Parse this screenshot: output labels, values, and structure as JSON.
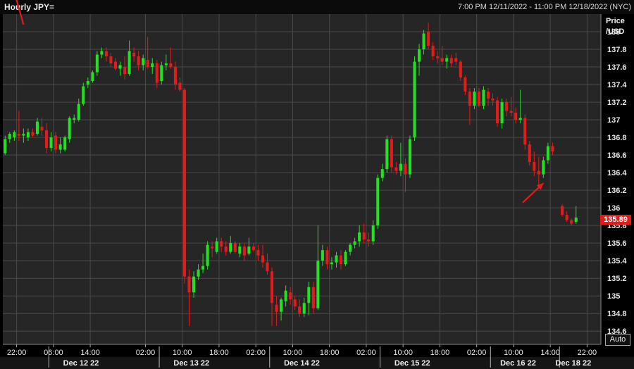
{
  "header": {
    "title": "Hourly JPY=",
    "range": "7:00 PM 12/11/2022 - 11:00 PM 12/18/2022 (NYC)"
  },
  "axis": {
    "ylabel_line1": "Price",
    "ylabel_line2": "/USD",
    "auto_label": "Auto"
  },
  "last_price": "135.89",
  "colors": {
    "up": "#22e022",
    "down": "#e41b1b",
    "background": "#262626"
  },
  "chart_data": {
    "type": "candlestick",
    "ylim": [
      134.45,
      138.2
    ],
    "yticks": [
      {
        "value": 138,
        "label": "138"
      },
      {
        "value": 137.8,
        "label": "137.8"
      },
      {
        "value": 137.6,
        "label": "137.6"
      },
      {
        "value": 137.4,
        "label": "137.4"
      },
      {
        "value": 137.2,
        "label": "137.2"
      },
      {
        "value": 137,
        "label": "137"
      },
      {
        "value": 136.8,
        "label": "136.8"
      },
      {
        "value": 136.6,
        "label": "136.6"
      },
      {
        "value": 136.4,
        "label": "136.4"
      },
      {
        "value": 136.2,
        "label": "136.2"
      },
      {
        "value": 136,
        "label": "136"
      },
      {
        "value": 135.8,
        "label": "135.8"
      },
      {
        "value": 135.6,
        "label": "135.6"
      },
      {
        "value": 135.4,
        "label": "135.4"
      },
      {
        "value": 135.2,
        "label": "135.2"
      },
      {
        "value": 135,
        "label": "135"
      },
      {
        "value": 134.8,
        "label": "134.8"
      },
      {
        "value": 134.6,
        "label": "134.6"
      }
    ],
    "time_ticks": [
      {
        "t": 0,
        "label": "22:00"
      },
      {
        "t": 8,
        "label": "06:00"
      },
      {
        "t": 16,
        "label": "14:00"
      },
      {
        "t": 28,
        "label": "02:00"
      },
      {
        "t": 36,
        "label": "10:00"
      },
      {
        "t": 44,
        "label": "18:00"
      },
      {
        "t": 52,
        "label": "02:00"
      },
      {
        "t": 60,
        "label": "10:00"
      },
      {
        "t": 68,
        "label": "18:00"
      },
      {
        "t": 76,
        "label": "02:00"
      },
      {
        "t": 84,
        "label": "10:00"
      },
      {
        "t": 92,
        "label": "18:00"
      },
      {
        "t": 100,
        "label": "02:00"
      },
      {
        "t": 108,
        "label": "10:00"
      },
      {
        "t": 116,
        "label": "14:00"
      },
      {
        "t": 124,
        "label": "22:00"
      }
    ],
    "date_labels": [
      {
        "t": 14,
        "label": "Dec 12 22"
      },
      {
        "t": 38,
        "label": "Dec 13 22"
      },
      {
        "t": 62,
        "label": "Dec 14 22"
      },
      {
        "t": 86,
        "label": "Dec 15 22"
      },
      {
        "t": 109,
        "label": "Dec 16 22"
      },
      {
        "t": 121,
        "label": "Dec 18 22"
      }
    ],
    "date_separators": [
      7,
      31,
      55,
      79,
      103,
      118
    ],
    "x_domain": [
      -3,
      127
    ],
    "candles": [
      {
        "t": -2.5,
        "o": 136.62,
        "h": 136.82,
        "l": 136.6,
        "c": 136.78
      },
      {
        "t": -1.5,
        "o": 136.78,
        "h": 136.86,
        "l": 136.74,
        "c": 136.84
      },
      {
        "t": -0.5,
        "o": 136.8,
        "h": 136.88,
        "l": 136.76,
        "c": 136.86
      },
      {
        "t": 0.5,
        "o": 136.84,
        "h": 137.1,
        "l": 136.76,
        "c": 136.82
      },
      {
        "t": 1.5,
        "o": 136.82,
        "h": 136.9,
        "l": 136.74,
        "c": 136.84
      },
      {
        "t": 2.5,
        "o": 136.8,
        "h": 136.9,
        "l": 136.76,
        "c": 136.86
      },
      {
        "t": 3.5,
        "o": 136.86,
        "h": 136.9,
        "l": 136.8,
        "c": 136.82
      },
      {
        "t": 4.5,
        "o": 136.84,
        "h": 137.02,
        "l": 136.82,
        "c": 136.98
      },
      {
        "t": 5.5,
        "o": 136.92,
        "h": 137.02,
        "l": 136.82,
        "c": 136.88
      },
      {
        "t": 6.5,
        "o": 136.88,
        "h": 136.96,
        "l": 136.62,
        "c": 136.68
      },
      {
        "t": 7.5,
        "o": 136.68,
        "h": 136.86,
        "l": 136.64,
        "c": 136.8
      },
      {
        "t": 8.5,
        "o": 136.82,
        "h": 136.86,
        "l": 136.62,
        "c": 136.66
      },
      {
        "t": 9.5,
        "o": 136.66,
        "h": 136.8,
        "l": 136.62,
        "c": 136.72
      },
      {
        "t": 10.5,
        "o": 136.66,
        "h": 136.82,
        "l": 136.64,
        "c": 136.8
      },
      {
        "t": 11.5,
        "o": 136.78,
        "h": 137.04,
        "l": 136.74,
        "c": 137.02
      },
      {
        "t": 12.5,
        "o": 137.0,
        "h": 137.06,
        "l": 136.96,
        "c": 137.02
      },
      {
        "t": 13.5,
        "o": 137.0,
        "h": 137.24,
        "l": 136.98,
        "c": 137.18
      },
      {
        "t": 14.5,
        "o": 137.18,
        "h": 137.42,
        "l": 137.16,
        "c": 137.38
      },
      {
        "t": 15.5,
        "o": 137.4,
        "h": 137.48,
        "l": 137.36,
        "c": 137.44
      },
      {
        "t": 16.5,
        "o": 137.44,
        "h": 137.56,
        "l": 137.42,
        "c": 137.54
      },
      {
        "t": 17.5,
        "o": 137.54,
        "h": 137.78,
        "l": 137.5,
        "c": 137.74
      },
      {
        "t": 18.5,
        "o": 137.74,
        "h": 137.82,
        "l": 137.7,
        "c": 137.78
      },
      {
        "t": 19.5,
        "o": 137.78,
        "h": 137.82,
        "l": 137.66,
        "c": 137.72
      },
      {
        "t": 20.5,
        "o": 137.72,
        "h": 137.76,
        "l": 137.6,
        "c": 137.64
      },
      {
        "t": 21.5,
        "o": 137.66,
        "h": 137.7,
        "l": 137.56,
        "c": 137.58
      },
      {
        "t": 22.5,
        "o": 137.58,
        "h": 137.66,
        "l": 137.5,
        "c": 137.62
      },
      {
        "t": 23.5,
        "o": 137.6,
        "h": 137.72,
        "l": 137.46,
        "c": 137.52
      },
      {
        "t": 24.5,
        "o": 137.52,
        "h": 137.9,
        "l": 137.5,
        "c": 137.78
      },
      {
        "t": 25.5,
        "o": 137.76,
        "h": 137.82,
        "l": 137.66,
        "c": 137.72
      },
      {
        "t": 26.5,
        "o": 137.72,
        "h": 137.78,
        "l": 137.56,
        "c": 137.62
      },
      {
        "t": 27.5,
        "o": 137.62,
        "h": 137.74,
        "l": 137.56,
        "c": 137.7
      },
      {
        "t": 28.5,
        "o": 137.68,
        "h": 137.94,
        "l": 137.58,
        "c": 137.6
      },
      {
        "t": 29.5,
        "o": 137.6,
        "h": 137.7,
        "l": 137.52,
        "c": 137.64
      },
      {
        "t": 30.5,
        "o": 137.64,
        "h": 137.68,
        "l": 137.36,
        "c": 137.42
      },
      {
        "t": 31.5,
        "o": 137.44,
        "h": 137.66,
        "l": 137.4,
        "c": 137.62
      },
      {
        "t": 32.5,
        "o": 137.62,
        "h": 137.74,
        "l": 137.56,
        "c": 137.64
      },
      {
        "t": 33.5,
        "o": 137.64,
        "h": 137.82,
        "l": 137.58,
        "c": 137.6
      },
      {
        "t": 34.5,
        "o": 137.6,
        "h": 137.66,
        "l": 137.34,
        "c": 137.4
      },
      {
        "t": 35.5,
        "o": 137.42,
        "h": 137.48,
        "l": 137.32,
        "c": 137.34
      },
      {
        "t": 36.5,
        "o": 137.34,
        "h": 137.36,
        "l": 135.14,
        "c": 135.22
      },
      {
        "t": 37.5,
        "o": 135.22,
        "h": 135.3,
        "l": 134.66,
        "c": 135.04
      },
      {
        "t": 38.5,
        "o": 135.04,
        "h": 135.28,
        "l": 134.98,
        "c": 135.22
      },
      {
        "t": 39.5,
        "o": 135.22,
        "h": 135.36,
        "l": 135.18,
        "c": 135.3
      },
      {
        "t": 40.5,
        "o": 135.3,
        "h": 135.48,
        "l": 135.26,
        "c": 135.34
      },
      {
        "t": 41.5,
        "o": 135.34,
        "h": 135.62,
        "l": 135.3,
        "c": 135.58
      },
      {
        "t": 42.5,
        "o": 135.56,
        "h": 135.62,
        "l": 135.44,
        "c": 135.54
      },
      {
        "t": 43.5,
        "o": 135.5,
        "h": 135.66,
        "l": 135.48,
        "c": 135.62
      },
      {
        "t": 44.5,
        "o": 135.62,
        "h": 135.66,
        "l": 135.5,
        "c": 135.56
      },
      {
        "t": 45.5,
        "o": 135.56,
        "h": 135.62,
        "l": 135.46,
        "c": 135.5
      },
      {
        "t": 46.5,
        "o": 135.5,
        "h": 135.68,
        "l": 135.48,
        "c": 135.6
      },
      {
        "t": 47.5,
        "o": 135.6,
        "h": 135.62,
        "l": 135.48,
        "c": 135.5
      },
      {
        "t": 48.5,
        "o": 135.48,
        "h": 135.6,
        "l": 135.44,
        "c": 135.56
      },
      {
        "t": 49.5,
        "o": 135.56,
        "h": 135.6,
        "l": 135.4,
        "c": 135.46
      },
      {
        "t": 50.5,
        "o": 135.48,
        "h": 135.66,
        "l": 135.46,
        "c": 135.56
      },
      {
        "t": 51.5,
        "o": 135.56,
        "h": 135.6,
        "l": 135.5,
        "c": 135.52
      },
      {
        "t": 52.5,
        "o": 135.52,
        "h": 135.58,
        "l": 135.4,
        "c": 135.46
      },
      {
        "t": 53.5,
        "o": 135.46,
        "h": 135.58,
        "l": 135.32,
        "c": 135.38
      },
      {
        "t": 54.5,
        "o": 135.38,
        "h": 135.48,
        "l": 135.24,
        "c": 135.28
      },
      {
        "t": 55.5,
        "o": 135.28,
        "h": 135.32,
        "l": 134.66,
        "c": 134.92
      },
      {
        "t": 56.5,
        "o": 134.9,
        "h": 135.0,
        "l": 134.66,
        "c": 134.82
      },
      {
        "t": 57.5,
        "o": 134.82,
        "h": 134.98,
        "l": 134.72,
        "c": 134.96
      },
      {
        "t": 58.5,
        "o": 134.94,
        "h": 135.12,
        "l": 134.88,
        "c": 135.06
      },
      {
        "t": 59.5,
        "o": 135.04,
        "h": 135.1,
        "l": 134.9,
        "c": 134.96
      },
      {
        "t": 60.5,
        "o": 134.96,
        "h": 135.0,
        "l": 134.84,
        "c": 134.88
      },
      {
        "t": 61.5,
        "o": 134.88,
        "h": 134.96,
        "l": 134.76,
        "c": 134.8
      },
      {
        "t": 62.5,
        "o": 134.8,
        "h": 134.98,
        "l": 134.76,
        "c": 134.92
      },
      {
        "t": 63.5,
        "o": 134.92,
        "h": 135.16,
        "l": 134.78,
        "c": 135.1
      },
      {
        "t": 64.5,
        "o": 135.1,
        "h": 135.16,
        "l": 134.8,
        "c": 134.86
      },
      {
        "t": 65.5,
        "o": 134.86,
        "h": 135.8,
        "l": 134.84,
        "c": 135.4
      },
      {
        "t": 66.5,
        "o": 135.4,
        "h": 135.58,
        "l": 135.34,
        "c": 135.52
      },
      {
        "t": 67.5,
        "o": 135.52,
        "h": 135.56,
        "l": 135.3,
        "c": 135.36
      },
      {
        "t": 68.5,
        "o": 135.36,
        "h": 135.44,
        "l": 135.3,
        "c": 135.38
      },
      {
        "t": 69.5,
        "o": 135.38,
        "h": 135.5,
        "l": 135.32,
        "c": 135.46
      },
      {
        "t": 70.5,
        "o": 135.46,
        "h": 135.52,
        "l": 135.3,
        "c": 135.36
      },
      {
        "t": 71.5,
        "o": 135.36,
        "h": 135.52,
        "l": 135.34,
        "c": 135.5
      },
      {
        "t": 72.5,
        "o": 135.5,
        "h": 135.6,
        "l": 135.46,
        "c": 135.58
      },
      {
        "t": 73.5,
        "o": 135.58,
        "h": 135.66,
        "l": 135.54,
        "c": 135.62
      },
      {
        "t": 74.5,
        "o": 135.62,
        "h": 135.8,
        "l": 135.56,
        "c": 135.72
      },
      {
        "t": 75.5,
        "o": 135.72,
        "h": 135.82,
        "l": 135.6,
        "c": 135.64
      },
      {
        "t": 76.5,
        "o": 135.64,
        "h": 135.72,
        "l": 135.56,
        "c": 135.62
      },
      {
        "t": 77.5,
        "o": 135.62,
        "h": 135.86,
        "l": 135.58,
        "c": 135.8
      },
      {
        "t": 78.5,
        "o": 135.8,
        "h": 136.38,
        "l": 135.76,
        "c": 136.34
      },
      {
        "t": 79.5,
        "o": 136.34,
        "h": 136.5,
        "l": 136.3,
        "c": 136.44
      },
      {
        "t": 80.5,
        "o": 136.44,
        "h": 136.82,
        "l": 136.4,
        "c": 136.78
      },
      {
        "t": 81.5,
        "o": 136.78,
        "h": 136.82,
        "l": 136.4,
        "c": 136.46
      },
      {
        "t": 82.5,
        "o": 136.46,
        "h": 136.52,
        "l": 136.38,
        "c": 136.42
      },
      {
        "t": 83.5,
        "o": 136.42,
        "h": 136.74,
        "l": 136.36,
        "c": 136.5
      },
      {
        "t": 84.5,
        "o": 136.5,
        "h": 136.56,
        "l": 136.18,
        "c": 136.38
      },
      {
        "t": 85.5,
        "o": 136.38,
        "h": 136.82,
        "l": 136.34,
        "c": 136.78
      },
      {
        "t": 86.5,
        "o": 136.8,
        "h": 137.72,
        "l": 136.76,
        "c": 137.66
      },
      {
        "t": 87.5,
        "o": 137.66,
        "h": 137.86,
        "l": 137.5,
        "c": 137.8
      },
      {
        "t": 88.5,
        "o": 137.8,
        "h": 138.02,
        "l": 137.74,
        "c": 137.98
      },
      {
        "t": 89.5,
        "o": 138.0,
        "h": 138.1,
        "l": 137.8,
        "c": 137.84
      },
      {
        "t": 90.5,
        "o": 137.84,
        "h": 137.88,
        "l": 137.68,
        "c": 137.72
      },
      {
        "t": 91.5,
        "o": 137.72,
        "h": 137.78,
        "l": 137.64,
        "c": 137.7
      },
      {
        "t": 92.5,
        "o": 137.7,
        "h": 137.84,
        "l": 137.62,
        "c": 137.66
      },
      {
        "t": 93.5,
        "o": 137.66,
        "h": 137.74,
        "l": 137.58,
        "c": 137.7
      },
      {
        "t": 94.5,
        "o": 137.7,
        "h": 137.74,
        "l": 137.6,
        "c": 137.64
      },
      {
        "t": 95.5,
        "o": 137.7,
        "h": 137.76,
        "l": 137.62,
        "c": 137.66
      },
      {
        "t": 96.5,
        "o": 137.66,
        "h": 137.68,
        "l": 137.44,
        "c": 137.48
      },
      {
        "t": 97.5,
        "o": 137.48,
        "h": 137.5,
        "l": 137.28,
        "c": 137.32
      },
      {
        "t": 98.5,
        "o": 137.32,
        "h": 137.36,
        "l": 136.94,
        "c": 137.16
      },
      {
        "t": 99.5,
        "o": 137.16,
        "h": 137.36,
        "l": 137.12,
        "c": 137.32
      },
      {
        "t": 100.5,
        "o": 137.32,
        "h": 137.36,
        "l": 137.14,
        "c": 137.16
      },
      {
        "t": 101.5,
        "o": 137.16,
        "h": 137.38,
        "l": 137.12,
        "c": 137.34
      },
      {
        "t": 102.5,
        "o": 137.32,
        "h": 137.36,
        "l": 137.16,
        "c": 137.24
      },
      {
        "t": 103.5,
        "o": 137.24,
        "h": 137.3,
        "l": 137.16,
        "c": 137.22
      },
      {
        "t": 104.5,
        "o": 137.22,
        "h": 137.26,
        "l": 136.92,
        "c": 136.96
      },
      {
        "t": 105.5,
        "o": 136.96,
        "h": 137.24,
        "l": 136.9,
        "c": 137.2
      },
      {
        "t": 106.5,
        "o": 137.2,
        "h": 137.24,
        "l": 137.04,
        "c": 137.1
      },
      {
        "t": 107.5,
        "o": 137.1,
        "h": 137.26,
        "l": 137.04,
        "c": 137.08
      },
      {
        "t": 108.5,
        "o": 137.08,
        "h": 137.14,
        "l": 136.96,
        "c": 137.0
      },
      {
        "t": 109.5,
        "o": 137.0,
        "h": 137.34,
        "l": 136.96,
        "c": 137.02
      },
      {
        "t": 110.5,
        "o": 137.02,
        "h": 137.06,
        "l": 136.66,
        "c": 136.72
      },
      {
        "t": 111.5,
        "o": 136.72,
        "h": 136.76,
        "l": 136.48,
        "c": 136.52
      },
      {
        "t": 112.5,
        "o": 136.52,
        "h": 136.64,
        "l": 136.36,
        "c": 136.42
      },
      {
        "t": 113.5,
        "o": 136.42,
        "h": 136.58,
        "l": 136.22,
        "c": 136.38
      },
      {
        "t": 114.5,
        "o": 136.38,
        "h": 136.58,
        "l": 136.34,
        "c": 136.54
      },
      {
        "t": 115.5,
        "o": 136.54,
        "h": 136.74,
        "l": 136.5,
        "c": 136.7
      },
      {
        "t": 116.5,
        "o": 136.7,
        "h": 136.74,
        "l": 136.6,
        "c": 136.64
      },
      {
        "t": 118.6,
        "o": 136.02,
        "h": 136.04,
        "l": 135.9,
        "c": 135.92
      },
      {
        "t": 119.6,
        "o": 135.92,
        "h": 135.96,
        "l": 135.84,
        "c": 135.86
      },
      {
        "t": 120.6,
        "o": 135.86,
        "h": 135.88,
        "l": 135.8,
        "c": 135.82
      },
      {
        "t": 121.6,
        "o": 135.84,
        "h": 136.02,
        "l": 135.82,
        "c": 135.89
      }
    ],
    "annotations": [
      {
        "type": "arrow",
        "from_t": 1.5,
        "from_v": 138.08,
        "to_t": -0.5,
        "to_v": 138.45
      },
      {
        "type": "arrow",
        "from_t": 110,
        "from_v": 136.06,
        "to_t": 114.5,
        "to_v": 136.28
      }
    ]
  }
}
